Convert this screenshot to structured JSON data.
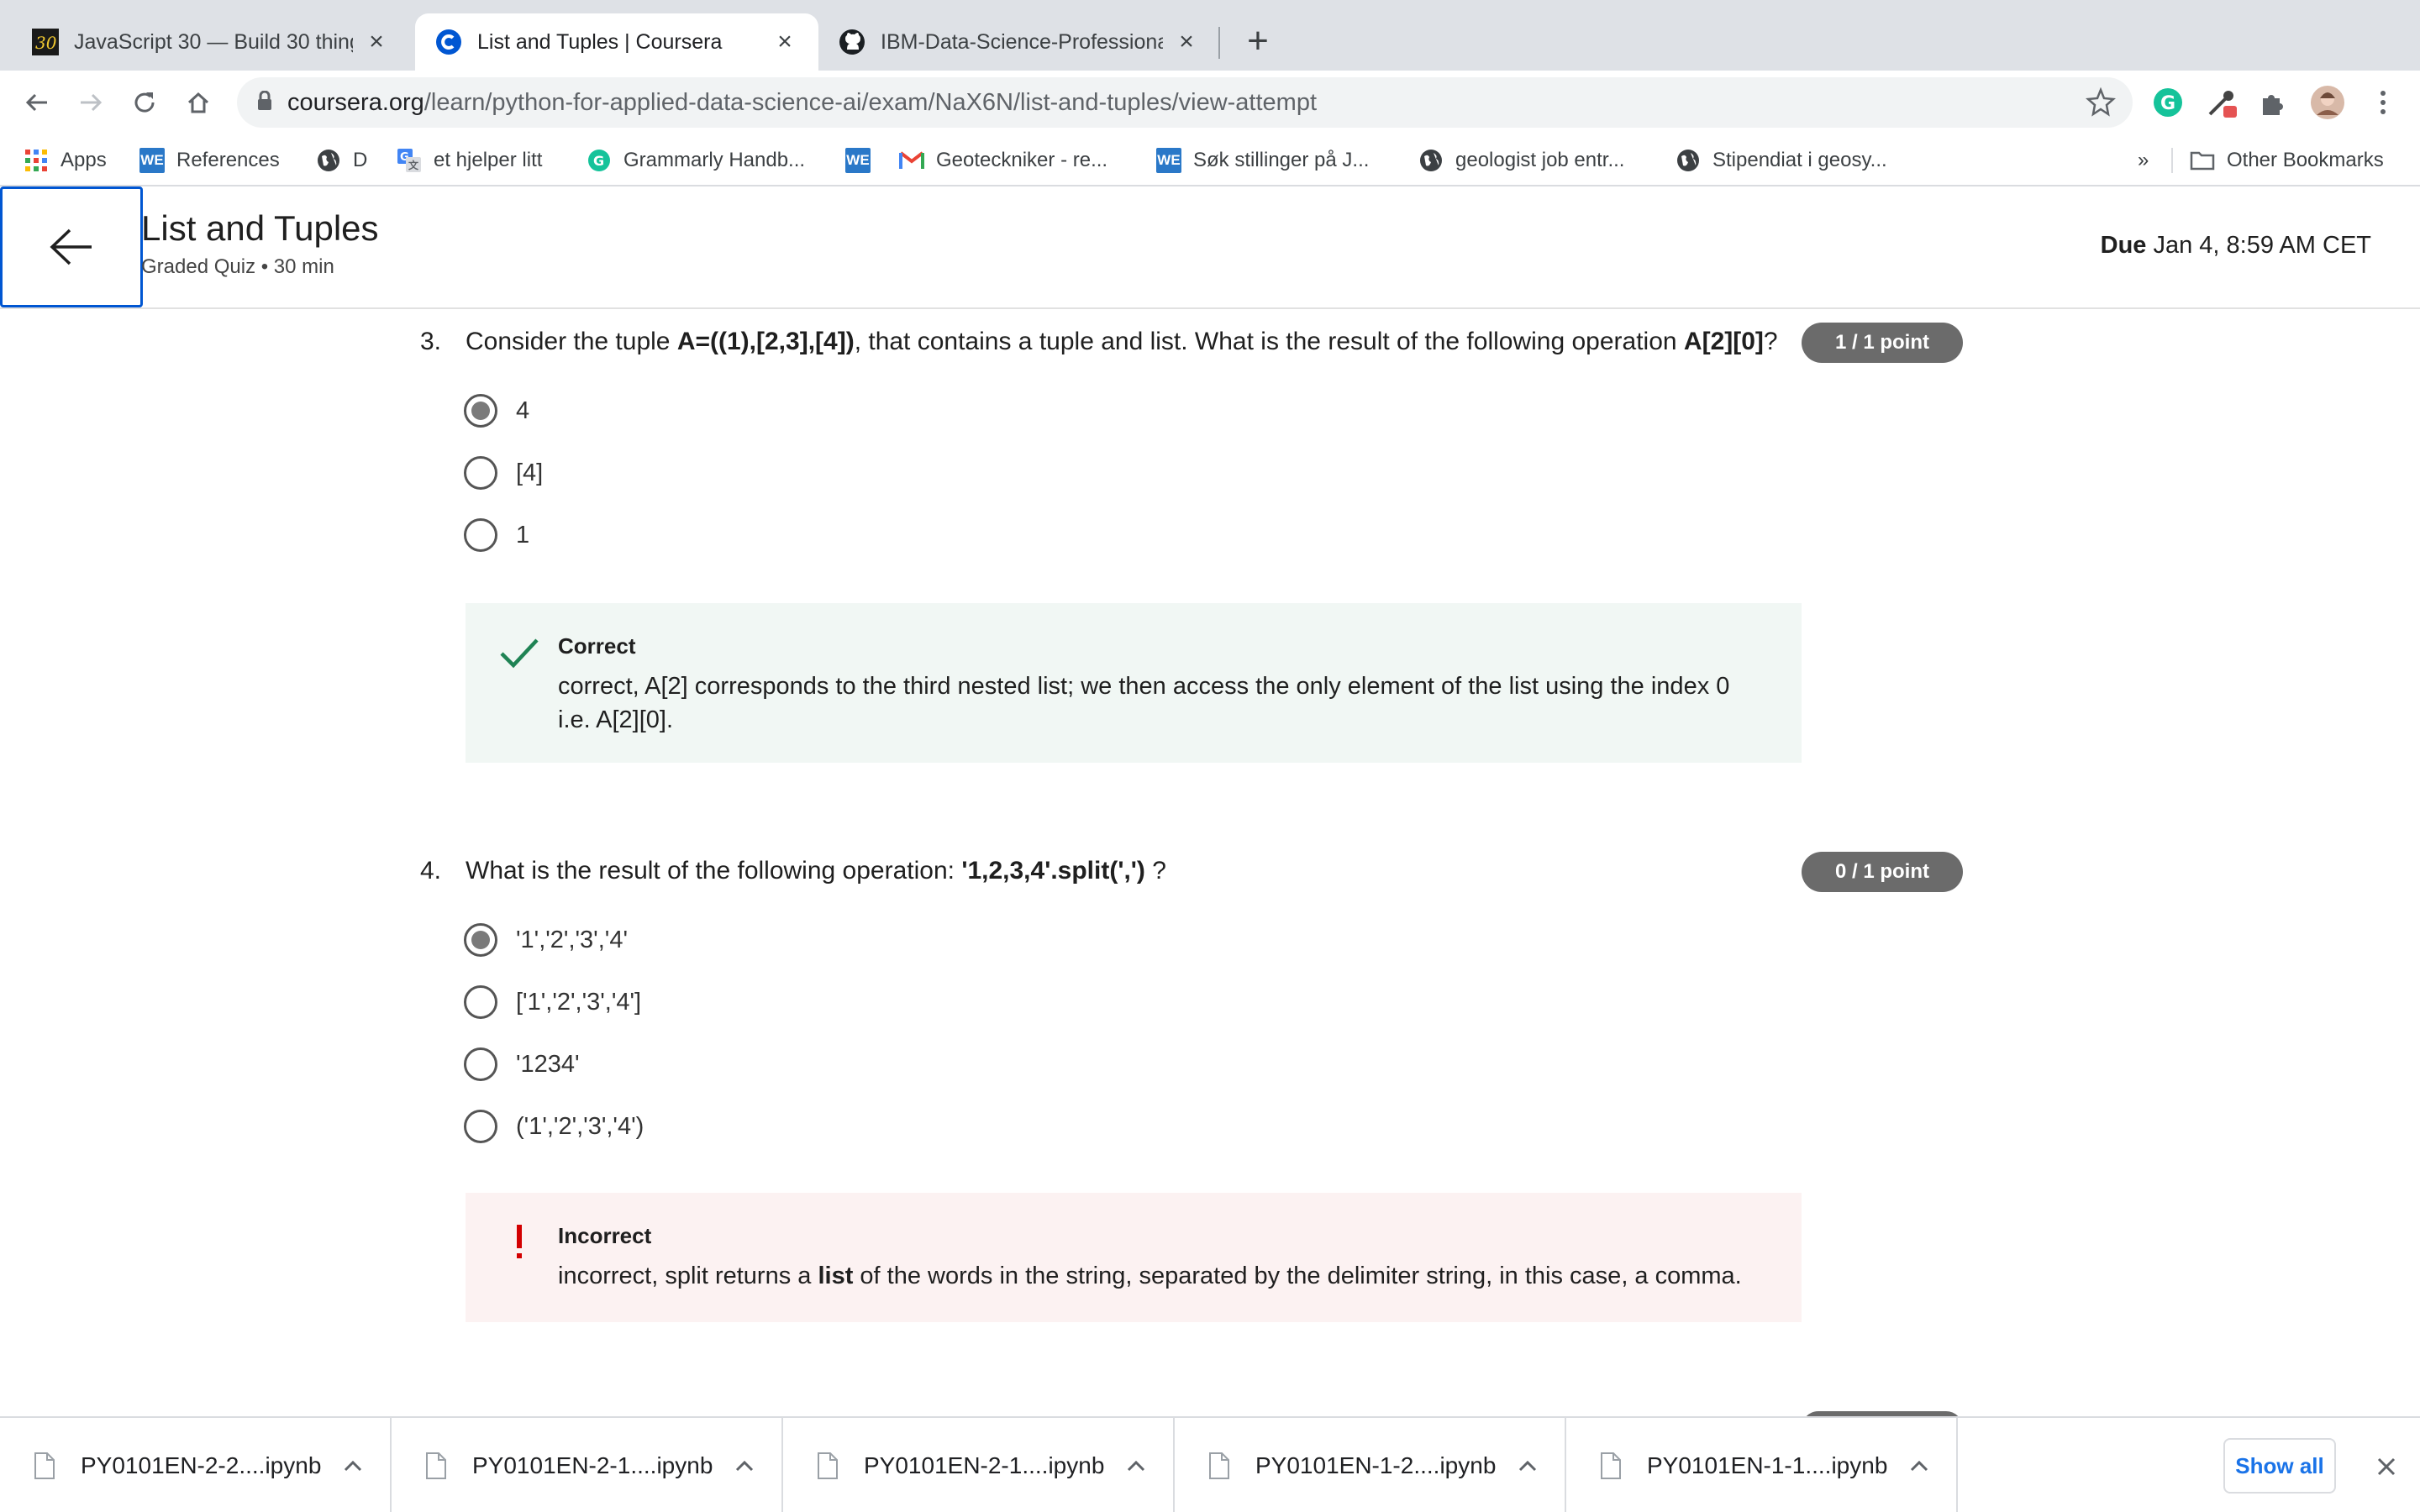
{
  "browser": {
    "tabs": [
      {
        "title": "JavaScript 30 — Build 30 things",
        "favicon": "js30-icon",
        "active": false
      },
      {
        "title": "List and Tuples | Coursera",
        "favicon": "coursera-icon",
        "active": true
      },
      {
        "title": "IBM-Data-Science-Professional",
        "favicon": "github-icon",
        "active": false
      }
    ],
    "url_host": "coursera.org",
    "url_path": "/learn/python-for-applied-data-science-ai/exam/NaX6N/list-and-tuples/view-attempt",
    "bookmarks": [
      {
        "label": "Apps",
        "icon": "apps-grid-icon"
      },
      {
        "label": "References",
        "icon": "we-icon"
      },
      {
        "label": "D",
        "icon": "globe-icon"
      },
      {
        "label": "et hjelper litt",
        "icon": "translate-icon"
      },
      {
        "label": "Grammarly Handb...",
        "icon": "grammarly-icon"
      },
      {
        "label": "",
        "icon": "we-icon"
      },
      {
        "label": "Geoteckniker - re...",
        "icon": "gmail-icon"
      },
      {
        "label": "Søk stillinger på J...",
        "icon": "we-icon"
      },
      {
        "label": "geologist job entr...",
        "icon": "globe-icon"
      },
      {
        "label": "Stipendiat i geosy...",
        "icon": "globe-icon"
      }
    ],
    "bookmarks_overflow": "»",
    "other_bookmarks": "Other Bookmarks",
    "we_badge": "WE"
  },
  "header": {
    "title": "List and Tuples",
    "subtitle": "Graded Quiz • 30 min",
    "due_label": "Due",
    "due_value": "Jan 4, 8:59 AM CET"
  },
  "questions": [
    {
      "number": "3.",
      "text_pre": "Consider the tuple ",
      "text_bold1": "A=((1),[2,3],[4])",
      "text_mid": ", that contains a tuple and list. What is the result of the following operation ",
      "text_bold2": "A[2][0]",
      "text_post": "?",
      "score": "1 / 1 point",
      "options": [
        "4",
        "[4]",
        "1"
      ],
      "selected_index": 0,
      "feedback_title": "Correct",
      "feedback_line1": "correct, A[2] corresponds to the third nested list; we then access the only element of the list using the index 0",
      "feedback_line2": "i.e. A[2][0]."
    },
    {
      "number": "4.",
      "text_pre": "What is the result of the following operation: ",
      "text_bold1": "'1,2,3,4'.split(',')",
      "text_post": " ?",
      "score": "0 / 1 point",
      "options": [
        "'1','2','3','4'",
        "['1','2','3','4']",
        "'1234'",
        "('1','2','3','4')"
      ],
      "selected_index": 0,
      "feedback_title": "Incorrect",
      "feedback_pre": "incorrect, split returns a ",
      "feedback_bold": "list",
      "feedback_post": " of the words in the string, separated by the delimiter string, in this case, a comma."
    }
  ],
  "downloads": [
    {
      "name": "PY0101EN-2-2....ipynb"
    },
    {
      "name": "PY0101EN-2-1....ipynb"
    },
    {
      "name": "PY0101EN-2-1....ipynb"
    },
    {
      "name": "PY0101EN-1-2....ipynb"
    },
    {
      "name": "PY0101EN-1-1....ipynb"
    }
  ],
  "show_all": "Show all",
  "colors": {
    "accent": "#0056d2",
    "correct": "#1f8354",
    "incorrect": "#d30001",
    "badge": "#6b6b6b"
  }
}
